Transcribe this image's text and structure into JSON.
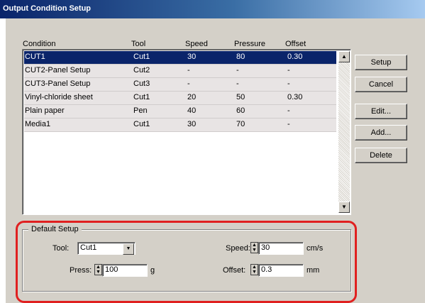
{
  "window": {
    "title": "Output Condition Setup"
  },
  "table": {
    "headers": [
      "Condition",
      "Tool",
      "Speed",
      "Pressure",
      "Offset"
    ],
    "rows": [
      [
        "CUT1",
        "Cut1",
        "30",
        "80",
        "0.30"
      ],
      [
        "CUT2-Panel Setup",
        "Cut2",
        "-",
        "-",
        "-"
      ],
      [
        "CUT3-Panel Setup",
        "Cut3",
        "-",
        "-",
        "-"
      ],
      [
        "Vinyl-chloride sheet",
        "Cut1",
        "20",
        "50",
        "0.30"
      ],
      [
        "Plain paper",
        "Pen",
        "40",
        "60",
        "-"
      ],
      [
        "Media1",
        "Cut1",
        "30",
        "70",
        "-"
      ]
    ],
    "selected_row": 0
  },
  "buttons": {
    "setup": "Setup",
    "cancel": "Cancel",
    "edit": "Edit...",
    "add": "Add...",
    "delete": "Delete"
  },
  "default_setup": {
    "title": "Default Setup",
    "tool_label": "Tool:",
    "tool_value": "Cut1",
    "press_label": "Press:",
    "press_value": "100",
    "press_unit": "g",
    "speed_label": "Speed:",
    "speed_value": "30",
    "speed_unit": "cm/s",
    "offset_label": "Offset:",
    "offset_value": "0.3",
    "offset_unit": "mm"
  },
  "colors": {
    "selection": "#0a246a",
    "highlight": "#e02020",
    "face": "#d4d0c8"
  }
}
